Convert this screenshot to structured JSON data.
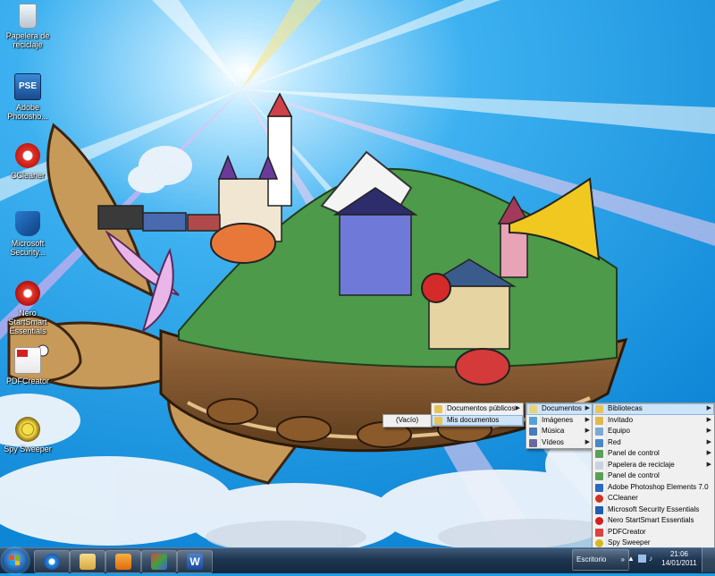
{
  "desktop": {
    "icons": [
      {
        "label": "Papelera de reciclaje",
        "icon": "recycle-bin-icon"
      },
      {
        "label": "Adobe Photosho...",
        "icon": "photoshop-elements-icon",
        "badge": "PSE"
      },
      {
        "label": "CCleaner",
        "icon": "ccleaner-icon"
      },
      {
        "label": "Microsoft Security...",
        "icon": "security-essentials-icon"
      },
      {
        "label": "Nero StartSmart Essentials",
        "icon": "nero-icon"
      },
      {
        "label": "PDFCreator",
        "icon": "pdfcreator-icon"
      },
      {
        "label": "Spy Sweeper",
        "icon": "spy-sweeper-icon"
      }
    ]
  },
  "menus": {
    "vacio": {
      "items": [
        {
          "label": "(Vacío)"
        }
      ]
    },
    "publicos": {
      "items": [
        {
          "label": "Documentos públicos",
          "submenu": true
        },
        {
          "label": "Mis documentos",
          "submenu": false,
          "highlighted": true
        }
      ]
    },
    "documentos": {
      "items": [
        {
          "label": "Documentos",
          "submenu": true,
          "highlighted": true
        },
        {
          "label": "Imágenes",
          "submenu": true
        },
        {
          "label": "Música",
          "submenu": true
        },
        {
          "label": "Vídeos",
          "submenu": true
        }
      ]
    },
    "escritorio": {
      "items": [
        {
          "label": "Bibliotecas",
          "submenu": true,
          "highlighted": true
        },
        {
          "label": "Invitado",
          "submenu": true
        },
        {
          "label": "Equipo",
          "submenu": true
        },
        {
          "label": "Red",
          "submenu": true
        },
        {
          "label": "Panel de control",
          "submenu": true
        },
        {
          "label": "Papelera de reciclaje",
          "submenu": true
        },
        {
          "label": "Panel de control",
          "submenu": false
        },
        {
          "label": "Adobe Photoshop Elements 7.0",
          "submenu": false
        },
        {
          "label": "CCleaner",
          "submenu": false
        },
        {
          "label": "Microsoft Security Essentials",
          "submenu": false
        },
        {
          "label": "Nero StartSmart Essentials",
          "submenu": false
        },
        {
          "label": "PDFCreator",
          "submenu": false
        },
        {
          "label": "Spy Sweeper",
          "submenu": false
        }
      ]
    }
  },
  "taskbar": {
    "toolbar_label": "Escritorio",
    "clock_time": "21:06",
    "clock_date": "14/01/2011",
    "pinned": [
      "internet-explorer-icon",
      "windows-explorer-icon",
      "media-player-icon",
      "paint-icon",
      "word-icon"
    ]
  },
  "colors": {
    "sky": "#1d9be3",
    "menu_bg": "#f0f0f0",
    "highlight": "#cde3f7",
    "taskbar": "#1d3550"
  }
}
